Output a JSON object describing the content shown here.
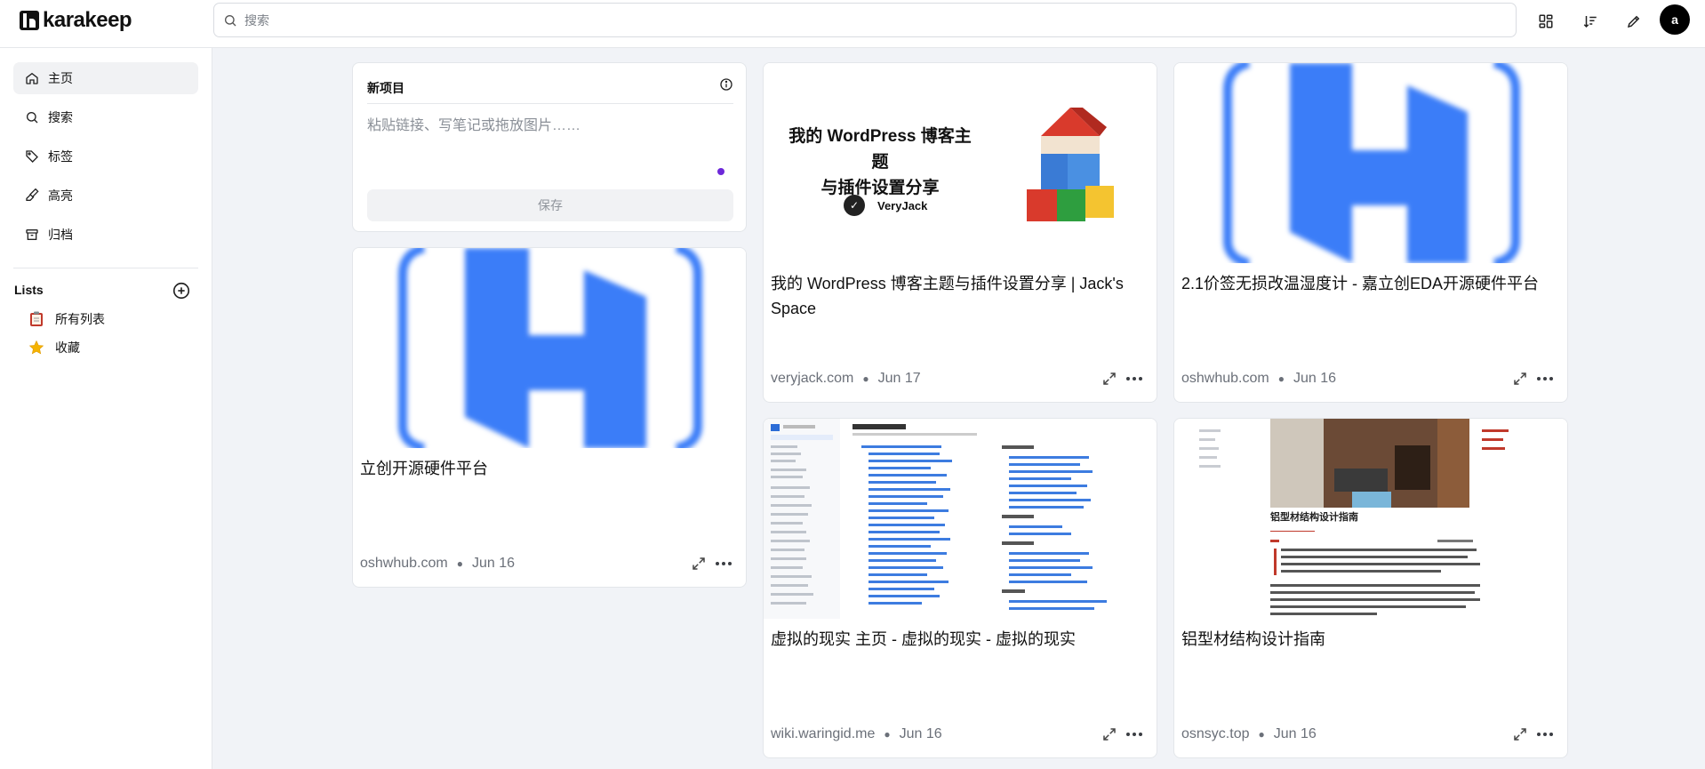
{
  "app": {
    "name": "karakeep"
  },
  "header": {
    "search_placeholder": "搜索",
    "avatar_letter": "a"
  },
  "sidebar": {
    "items": [
      {
        "label": "主页",
        "icon": "home-icon",
        "active": true
      },
      {
        "label": "搜索",
        "icon": "search-icon",
        "active": false
      },
      {
        "label": "标签",
        "icon": "tag-icon",
        "active": false
      },
      {
        "label": "高亮",
        "icon": "highlighter-icon",
        "active": false
      },
      {
        "label": "归档",
        "icon": "archive-icon",
        "active": false
      }
    ],
    "lists_title": "Lists",
    "lists": [
      {
        "label": "所有列表",
        "icon": "clipboard-emoji"
      },
      {
        "label": "收藏",
        "icon": "star-emoji"
      }
    ]
  },
  "new_item": {
    "title": "新项目",
    "placeholder": "粘贴链接、写笔记或拖放图片……",
    "save_label": "保存"
  },
  "bookmarks": [
    {
      "title": "我的 WordPress 博客主题与插件设置分享 | Jack's Space",
      "domain": "veryjack.com",
      "date": "Jun 17",
      "thumb": {
        "line1": "我的 WordPress 博客主题",
        "line2": "与插件设置分享",
        "brand": "VeryJack"
      }
    },
    {
      "title": "2.1价签无损改温湿度计 - 嘉立创EDA开源硬件平台",
      "domain": "oshwhub.com",
      "date": "Jun 16"
    },
    {
      "title": "立创开源硬件平台",
      "domain": "oshwhub.com",
      "date": "Jun 16"
    },
    {
      "title": "虚拟的现实 主页 - 虚拟的现实 - 虚拟的现实",
      "domain": "wiki.waringid.me",
      "date": "Jun 16"
    },
    {
      "title": "铝型材结构设计指南",
      "domain": "osnsyc.top",
      "date": "Jun 16",
      "thumb": {
        "heading": "铝型材结构设计指南"
      }
    }
  ],
  "colors": {
    "accent": "#6d28d9",
    "oshwhub_blue": "#3b7df8",
    "bg": "#f1f3f7"
  }
}
